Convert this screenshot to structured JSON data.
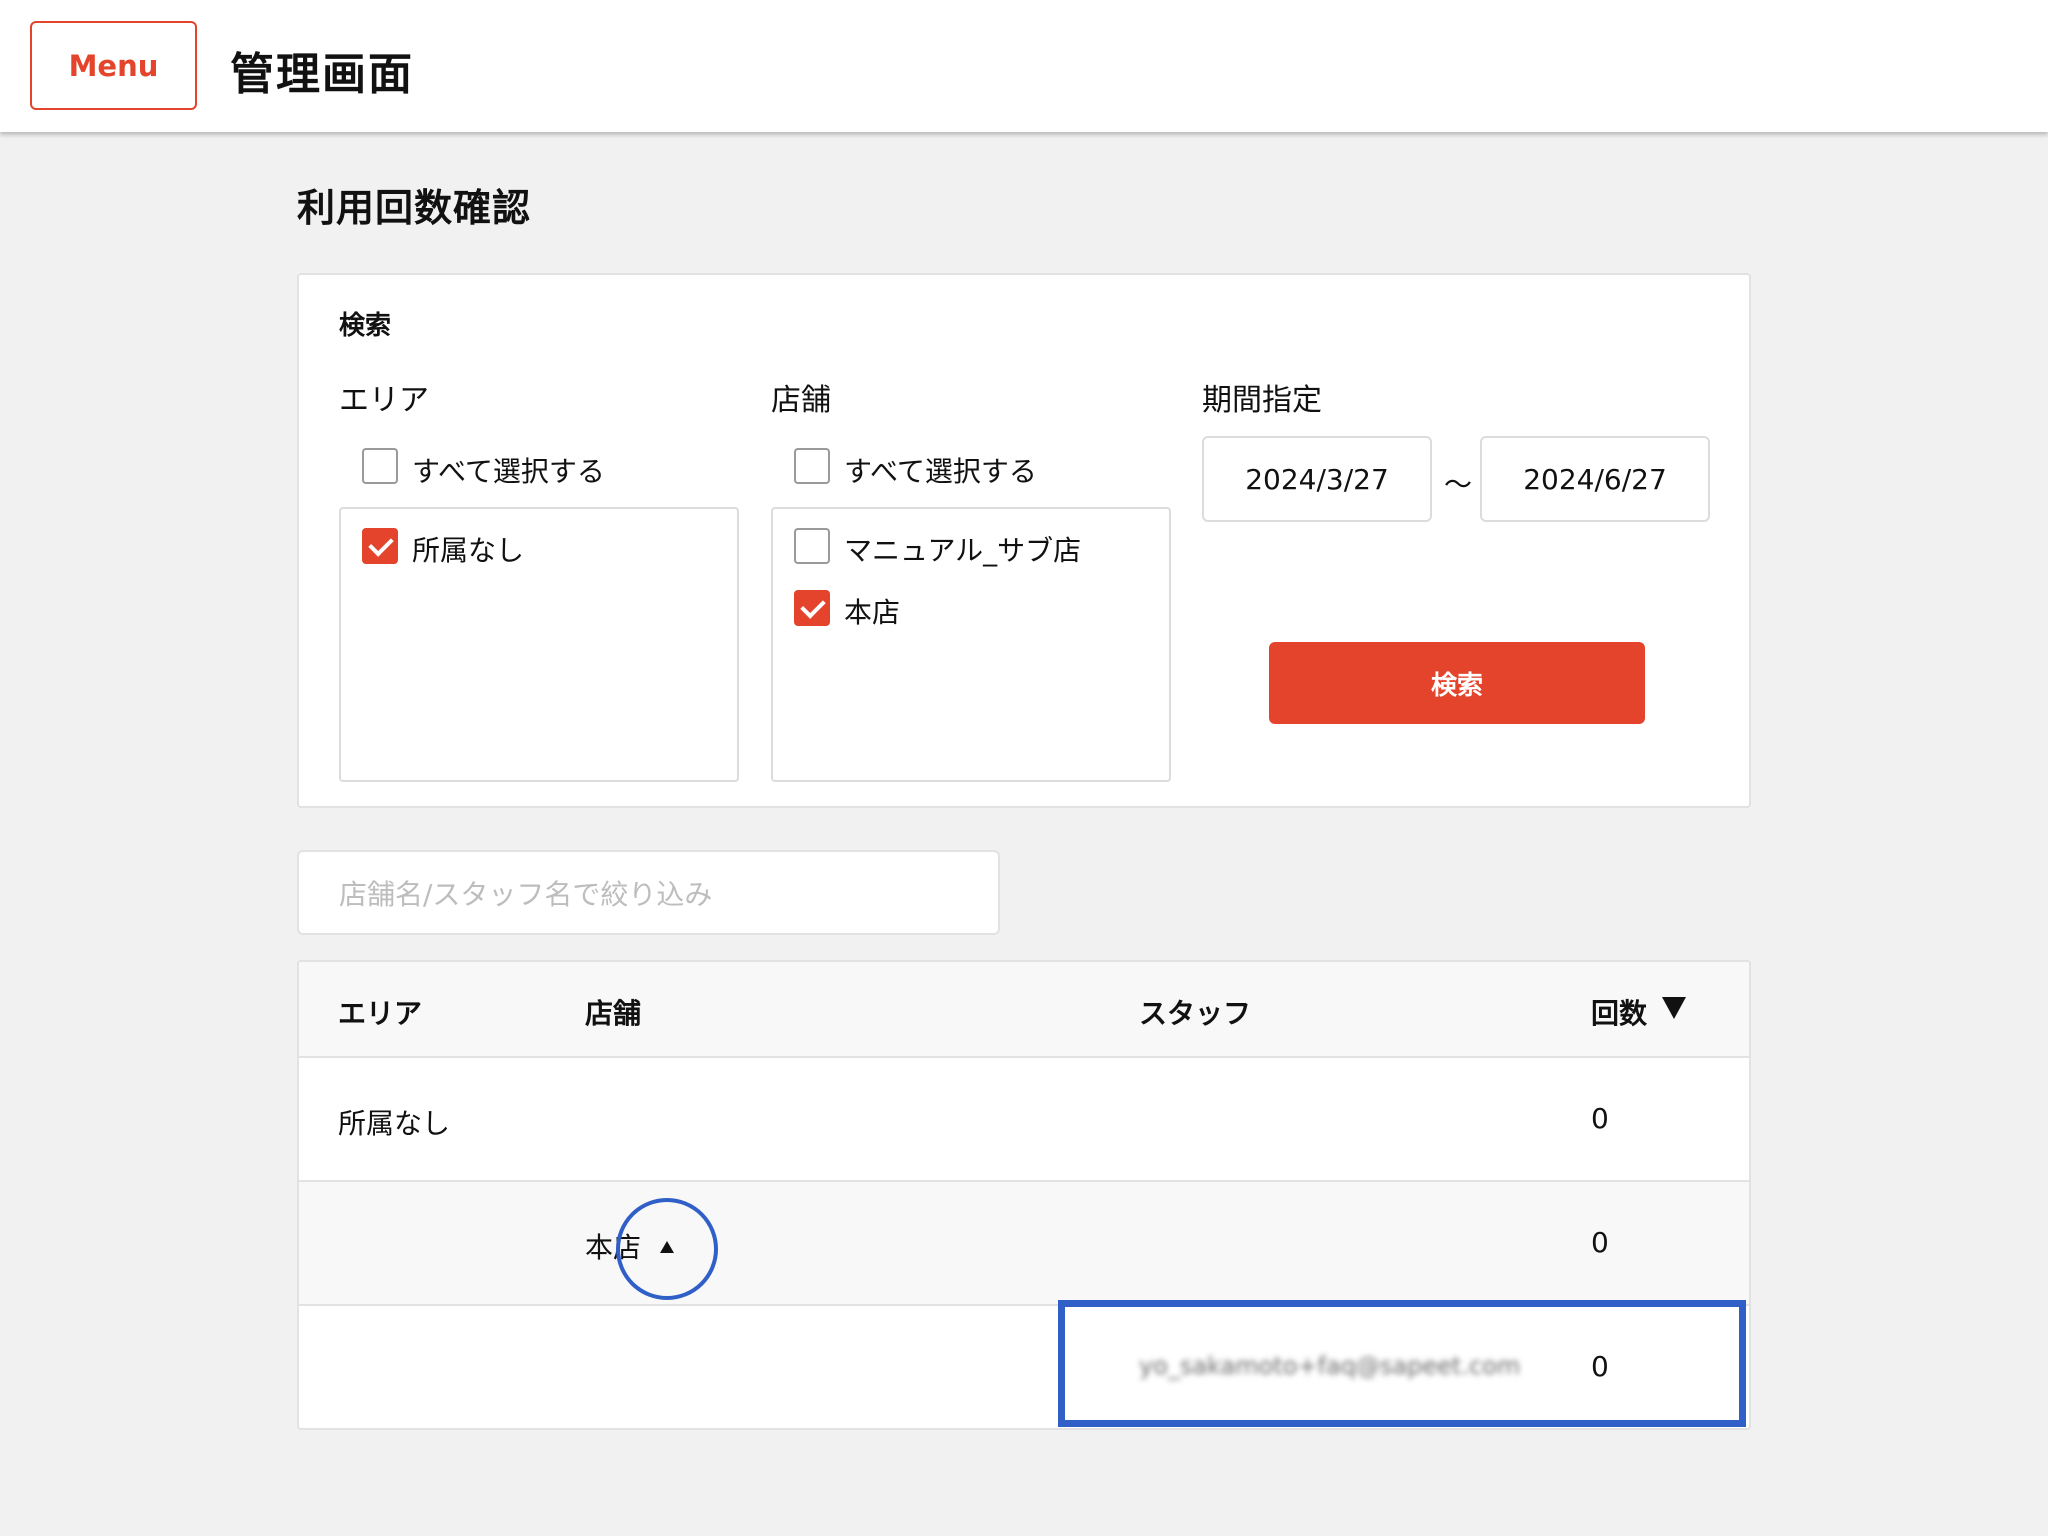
{
  "header": {
    "menu_label": "Menu",
    "app_title": "管理画面"
  },
  "page": {
    "title": "利用回数確認"
  },
  "search": {
    "title": "検索",
    "area": {
      "label": "エリア",
      "select_all": {
        "label": "すべて選択する",
        "checked": false
      },
      "items": [
        {
          "label": "所属なし",
          "checked": true
        }
      ]
    },
    "store": {
      "label": "店舗",
      "select_all": {
        "label": "すべて選択する",
        "checked": false
      },
      "items": [
        {
          "label": "マニュアル_サブ店",
          "checked": false
        },
        {
          "label": "本店",
          "checked": true
        }
      ]
    },
    "period": {
      "label": "期間指定",
      "from": "2024/3/27",
      "separator": "〜",
      "to": "2024/6/27"
    },
    "button_label": "検索"
  },
  "filter": {
    "placeholder": "店舗名/スタッフ名で絞り込み"
  },
  "table": {
    "headers": {
      "area": "エリア",
      "store": "店舗",
      "staff": "スタッフ",
      "count": "回数"
    },
    "sort": {
      "column": "count",
      "direction": "descending"
    },
    "rows": [
      {
        "area": "所属なし",
        "store": "",
        "staff": "",
        "count": "0"
      },
      {
        "area": "",
        "store": "本店",
        "staff": "",
        "count": "0",
        "expanded": true
      },
      {
        "area": "",
        "store": "",
        "staff": "yo_sakamoto+faq@sapeet.com",
        "count": "0"
      }
    ]
  },
  "colors": {
    "accent": "#e4442b",
    "annotation": "#2f5fc7",
    "background": "#f1f1f1"
  }
}
